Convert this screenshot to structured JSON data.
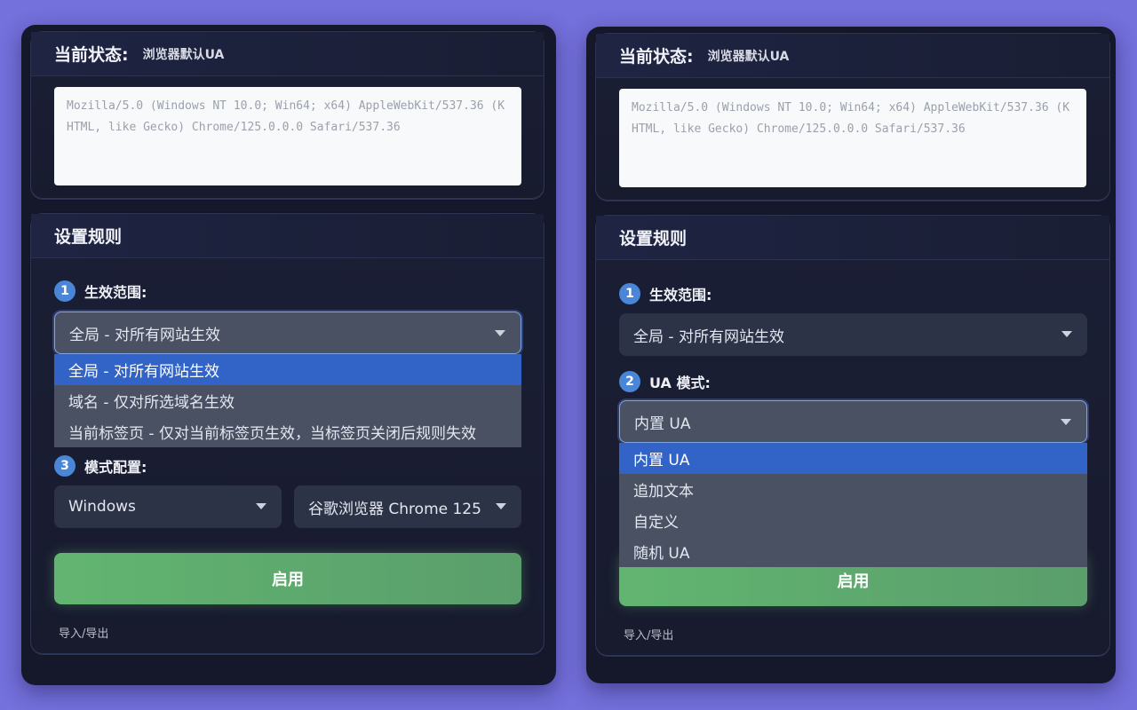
{
  "status": {
    "label": "当前状态:",
    "value": "浏览器默认UA",
    "ua_string": "Mozilla/5.0 (Windows NT 10.0; Win64; x64) AppleWebKit/537.36 (KHTML, like Gecko) Chrome/125.0.0.0 Safari/537.36"
  },
  "rules": {
    "title": "设置规则",
    "step1": {
      "num": "1",
      "label": "生效范围:",
      "selected": "全局 - 对所有网站生效"
    },
    "step2": {
      "num": "2",
      "label": "UA 模式:",
      "selected": "内置 UA"
    },
    "step3": {
      "num": "3",
      "label": "模式配置:",
      "os_selected": "Windows",
      "browser_selected": "谷歌浏览器 Chrome 125"
    },
    "scope_options": [
      "全局 - 对所有网站生效",
      "域名 - 仅对所选域名生效",
      "当前标签页 - 仅对当前标签页生效，当标签页关闭后规则失效"
    ],
    "mode_options": [
      "内置 UA",
      "追加文本",
      "自定义",
      "随机 UA"
    ],
    "enable_label": "启用",
    "import_export": "导入/导出"
  },
  "colors": {
    "background": "#7470dc",
    "panel": "#15182a",
    "accent_blue": "#3264c8",
    "enable_green": "#62b570"
  },
  "icons": [
    "caret-down-icon"
  ]
}
